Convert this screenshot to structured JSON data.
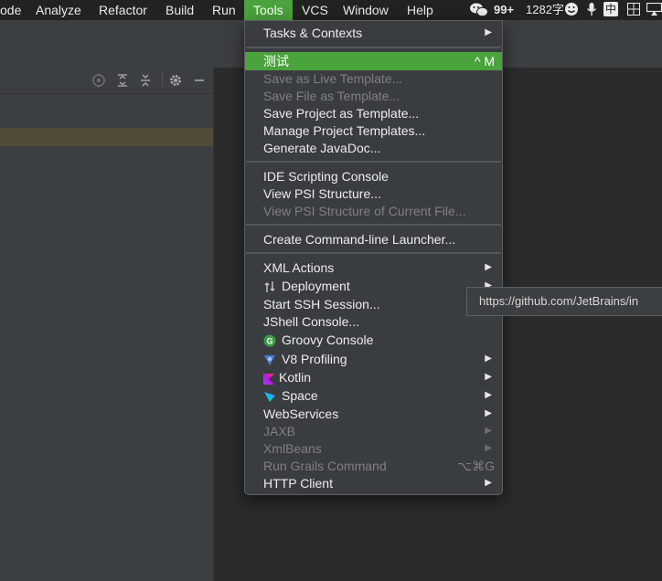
{
  "menubar": {
    "items": [
      {
        "label": "ode"
      },
      {
        "label": "Analyze"
      },
      {
        "label": "Refactor"
      },
      {
        "label": "Build"
      },
      {
        "label": "Run"
      },
      {
        "label": "Tools"
      },
      {
        "label": "VCS"
      },
      {
        "label": "Window"
      },
      {
        "label": "Help"
      }
    ],
    "tray": {
      "wechat_count": "99+",
      "word_count": "1282字",
      "input_method": "中"
    }
  },
  "tools_menu": {
    "items": [
      {
        "label": "Tasks & Contexts"
      },
      {
        "label": "测试",
        "shortcut": "^ M"
      },
      {
        "label": "Save as Live Template..."
      },
      {
        "label": "Save File as Template..."
      },
      {
        "label": "Save Project as Template..."
      },
      {
        "label": "Manage Project Templates..."
      },
      {
        "label": "Generate JavaDoc..."
      },
      {
        "label": "IDE Scripting Console"
      },
      {
        "label": "View PSI Structure..."
      },
      {
        "label": "View PSI Structure of Current File..."
      },
      {
        "label": "Create Command-line Launcher..."
      },
      {
        "label": "XML Actions"
      },
      {
        "label": "Deployment"
      },
      {
        "label": "Start SSH Session..."
      },
      {
        "label": "JShell Console..."
      },
      {
        "label": "Groovy Console"
      },
      {
        "label": "V8 Profiling"
      },
      {
        "label": "Kotlin"
      },
      {
        "label": "Space"
      },
      {
        "label": "WebServices"
      },
      {
        "label": "JAXB"
      },
      {
        "label": "XmlBeans"
      },
      {
        "label": "Run Grails Command",
        "shortcut": "⌥⌘G"
      },
      {
        "label": "HTTP Client"
      }
    ]
  },
  "tooltip": {
    "text": "https://github.com/JetBrains/in"
  },
  "colors": {
    "highlight": "#4aa33c",
    "menu_bg": "#3a3d40",
    "menubar_bg": "#222223"
  }
}
